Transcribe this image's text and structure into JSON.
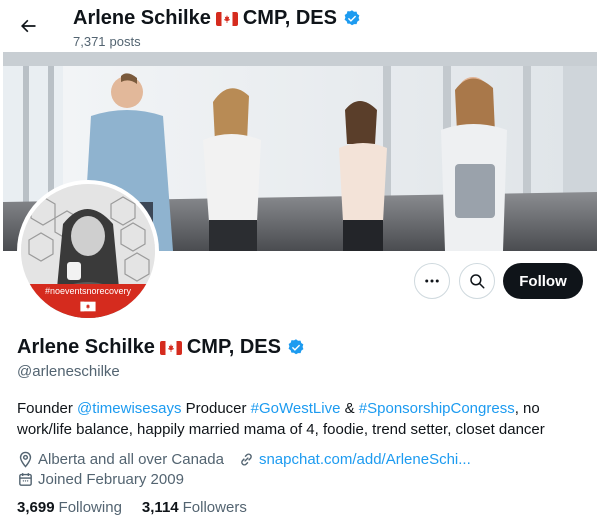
{
  "header": {
    "name": "Arlene Schilke",
    "suffix": "CMP, DES",
    "posts_count": "7,371",
    "posts_label": "posts"
  },
  "avatar": {
    "hashtag": "#noeventsnorecovery"
  },
  "actions": {
    "follow_label": "Follow"
  },
  "profile": {
    "name": "Arlene Schilke",
    "suffix": "CMP, DES",
    "handle": "@arleneschilke",
    "bio": {
      "p1": "Founder ",
      "link1": "@timewisesays",
      "p2": " Producer ",
      "link2": "#GoWestLive",
      "p3": " & ",
      "link3": "#SponsorshipCongress",
      "p4": ", no work/life balance, happily married mama of 4, foodie, trend setter, closet dancer"
    },
    "location": "Alberta and all over Canada",
    "website": "snapchat.com/add/ArleneSchi...",
    "joined": "Joined February 2009",
    "following_count": "3,699",
    "following_label": "Following",
    "followers_count": "3,114",
    "followers_label": "Followers"
  },
  "colors": {
    "accent": "#1d9bf0",
    "text": "#0f1419",
    "muted": "#536471",
    "flag_red": "#d52b1e"
  },
  "icons": {
    "back": "arrow-left-icon",
    "verified": "verified-badge-icon",
    "flag": "canada-flag-icon",
    "more": "more-icon",
    "search": "search-icon",
    "location": "location-pin-icon",
    "link": "link-icon",
    "calendar": "calendar-icon"
  }
}
